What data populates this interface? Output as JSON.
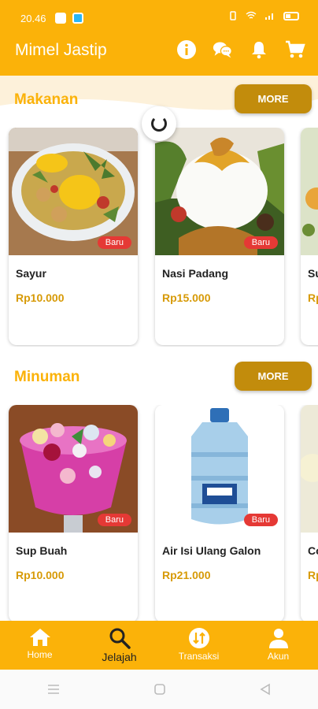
{
  "status_bar": {
    "time": "20.46"
  },
  "app_bar": {
    "title": "Mimel Jastip",
    "icons": [
      "info-icon",
      "chat-icon",
      "bell-icon",
      "cart-icon"
    ]
  },
  "sections": [
    {
      "title": "Makanan",
      "more_label": "MORE",
      "items": [
        {
          "name": "Sayur",
          "price": "Rp10.000",
          "badge": "Baru"
        },
        {
          "name": "Nasi Padang",
          "price": "Rp15.000",
          "badge": "Baru"
        },
        {
          "name": "Su",
          "price": "Rp",
          "badge": ""
        }
      ]
    },
    {
      "title": "Minuman",
      "more_label": "MORE",
      "items": [
        {
          "name": "Sup Buah",
          "price": "Rp10.000",
          "badge": "Baru"
        },
        {
          "name": "Air Isi Ulang Galon",
          "price": "Rp21.000",
          "badge": "Baru"
        },
        {
          "name": "Co",
          "price": "Rp",
          "badge": ""
        }
      ]
    }
  ],
  "bottom_nav": [
    {
      "label": "Home",
      "icon": "home-icon"
    },
    {
      "label": "Jelajah",
      "icon": "search-icon",
      "active": true
    },
    {
      "label": "Transaksi",
      "icon": "transaction-icon"
    },
    {
      "label": "Akun",
      "icon": "user-icon"
    }
  ],
  "colors": {
    "primary": "#FBB209",
    "button": "#C28C0C",
    "price": "#D79A07",
    "badge": "#E53935"
  }
}
